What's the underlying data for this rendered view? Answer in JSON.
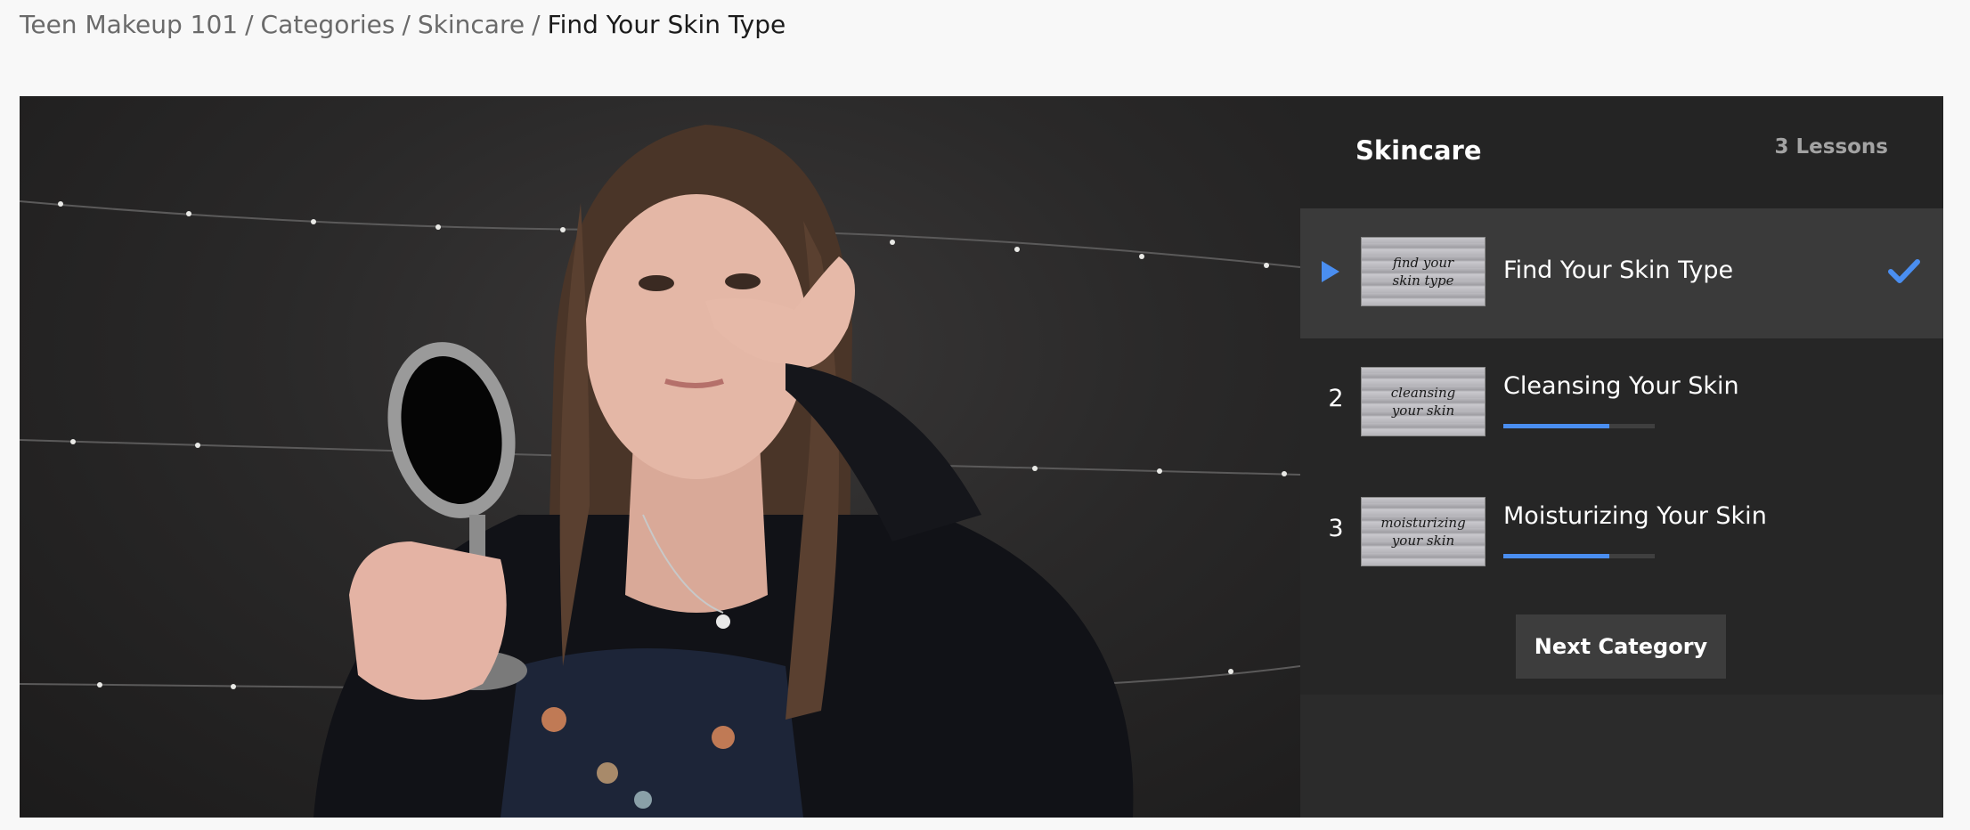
{
  "breadcrumb": {
    "items": [
      "Teen Makeup 101",
      "Categories",
      "Skincare"
    ],
    "separator": "/",
    "current": "Find Your Skin Type"
  },
  "sidebar": {
    "title": "Skincare",
    "lesson_count": "3 Lessons",
    "lessons": [
      {
        "number": "",
        "title": "Find Your Skin Type",
        "thumb_line1": "find your",
        "thumb_line2": "skin type",
        "state": "playing-completed"
      },
      {
        "number": "2",
        "title": "Cleansing Your Skin",
        "thumb_line1": "cleansing",
        "thumb_line2": "your skin",
        "progress_fraction": 0.7
      },
      {
        "number": "3",
        "title": "Moisturizing Your Skin",
        "thumb_line1": "moisturizing",
        "thumb_line2": "your skin",
        "progress_fraction": 0.7
      }
    ],
    "next_button": "Next Category"
  },
  "colors": {
    "accent": "#4a8ef0",
    "panel": "#262626",
    "active_row": "#3a3a3a"
  },
  "icons": [
    "play-icon",
    "checkmark-icon"
  ]
}
